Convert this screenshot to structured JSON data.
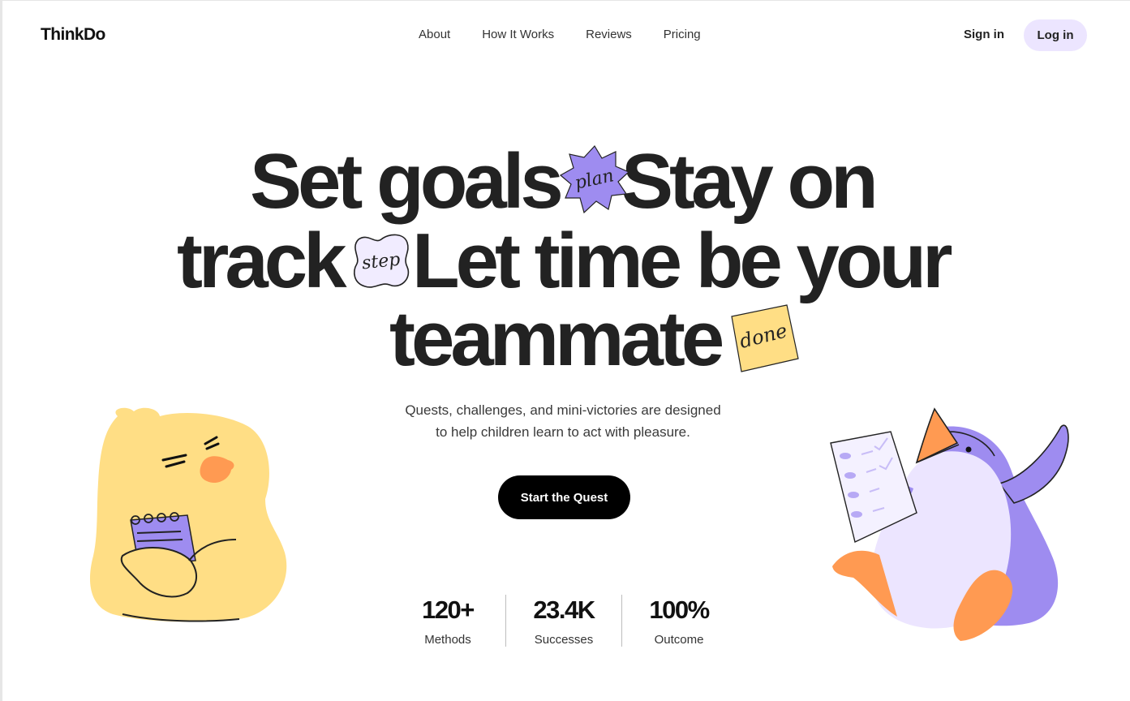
{
  "header": {
    "logo": "ThinkDo",
    "nav": [
      "About",
      "How It Works",
      "Reviews",
      "Pricing"
    ],
    "sign_in": "Sign in",
    "log_in": "Log in"
  },
  "hero": {
    "line1a": "Set goals",
    "line1b": "Stay on",
    "line2a": "track",
    "line2b": "Let time be your",
    "line3": "teammate",
    "sticker_plan": "plan",
    "sticker_step": "step",
    "sticker_done": "done",
    "subtitle_line1": "Quests, challenges, and mini-victories are designed",
    "subtitle_line2": "to help children learn to act with pleasure.",
    "cta": "Start the Quest"
  },
  "stats": [
    {
      "value": "120+",
      "label": "Methods"
    },
    {
      "value": "23.4K",
      "label": "Successes"
    },
    {
      "value": "100%",
      "label": "Outcome"
    }
  ],
  "colors": {
    "accent_purple": "#9e8cf0",
    "light_purple": "#ece5ff",
    "yellow": "#ffde85",
    "orange": "#ff9a52",
    "text": "#222222"
  },
  "icons": [
    "plan-star-sticker",
    "step-blob-sticker",
    "done-note-sticker",
    "chick-illustration",
    "penguin-illustration"
  ]
}
